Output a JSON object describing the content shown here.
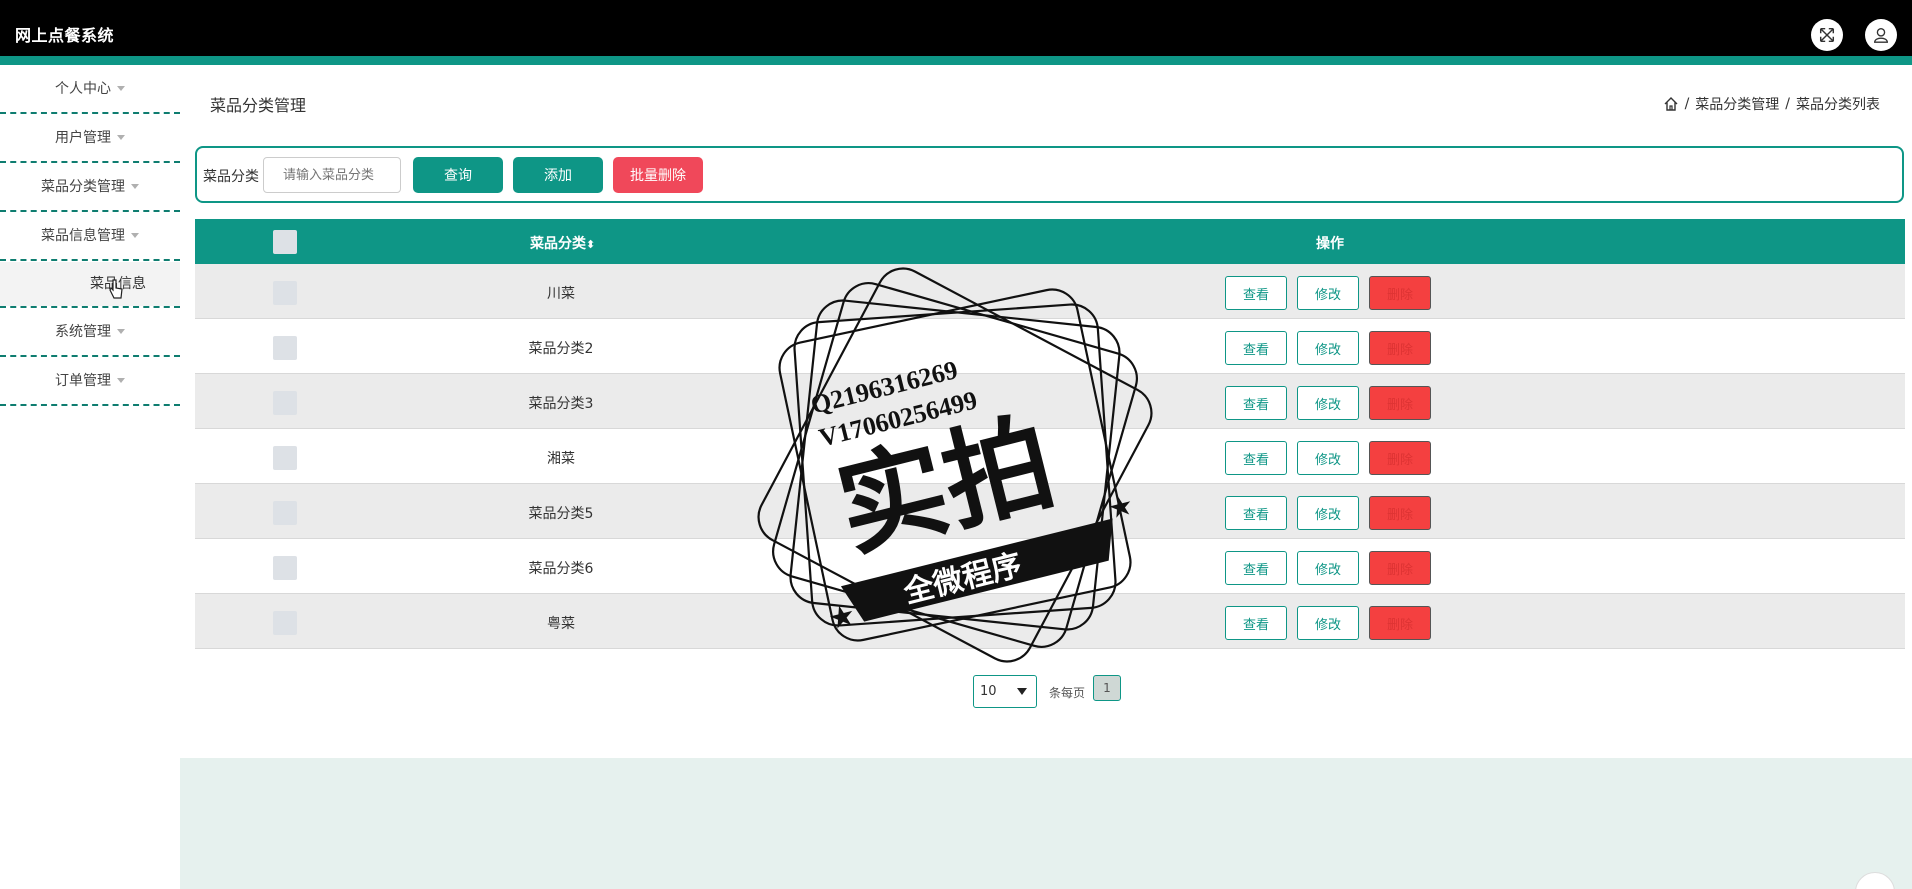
{
  "app": {
    "title": "网上点餐系统"
  },
  "header": {
    "icons": [
      "fullscreen-icon",
      "user-icon"
    ]
  },
  "sidebar": {
    "items": [
      {
        "label": "个人中心"
      },
      {
        "label": "用户管理"
      },
      {
        "label": "菜品分类管理"
      },
      {
        "label": "菜品信息管理"
      },
      {
        "label": "菜品信息",
        "sub": true
      },
      {
        "label": "系统管理"
      },
      {
        "label": "订单管理"
      }
    ]
  },
  "page": {
    "title": "菜品分类管理",
    "breadcrumb": [
      "菜品分类管理",
      "菜品分类列表"
    ],
    "breadcrumb_sep": "/"
  },
  "search": {
    "label": "菜品分类",
    "placeholder": "请输入菜品分类",
    "query_label": "查询",
    "add_label": "添加",
    "batch_delete_label": "批量删除"
  },
  "table": {
    "columns": {
      "name": "菜品分类",
      "sort_mark": "⬍",
      "actions": "操作"
    },
    "rows": [
      {
        "name": "川菜"
      },
      {
        "name": "菜品分类2"
      },
      {
        "name": "菜品分类3"
      },
      {
        "name": "湘菜"
      },
      {
        "name": "菜品分类5"
      },
      {
        "name": "菜品分类6"
      },
      {
        "name": "粤菜"
      }
    ],
    "action_labels": {
      "view": "查看",
      "edit": "修改",
      "delete": "删除"
    }
  },
  "pagination": {
    "page_size": "10",
    "per_page_label": "条每页",
    "current_page": "1"
  },
  "watermark": {
    "line1": "Q2196316269",
    "line2": "V17060256499",
    "main": "实拍",
    "banner": "全微程序"
  },
  "colors": {
    "accent": "#0e9686",
    "danger": "#f0485a",
    "topbar": "#000000"
  }
}
